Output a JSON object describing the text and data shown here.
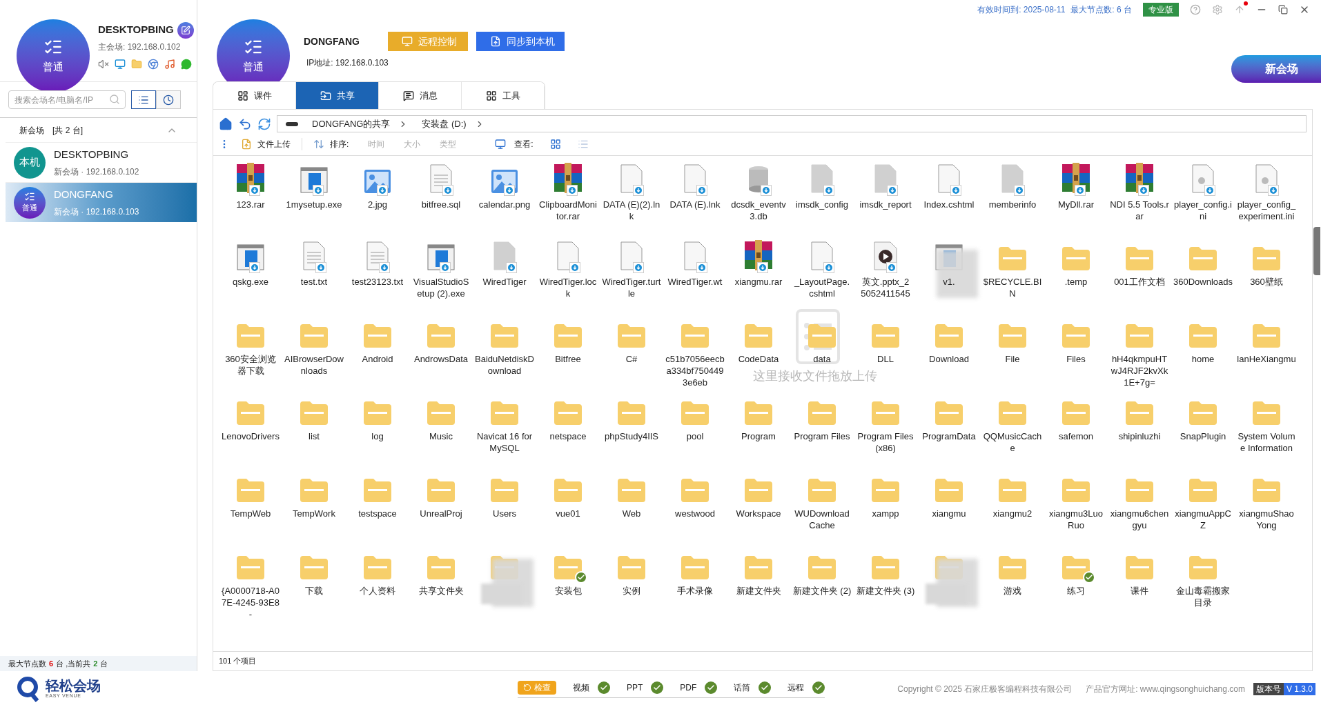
{
  "window": {
    "valid_until": "有效时间到: 2025-08-11",
    "max_nodes": "最大节点数: 6 台",
    "edition": "专业版"
  },
  "local": {
    "avatar": "普通",
    "name": "DESKTOPBING",
    "ip": "主会场: 192.168.0.102"
  },
  "sidebar": {
    "search": {
      "placeholder": "搜索会场名/电脑名/IP"
    },
    "view_toggles": [
      {
        "kind": "list",
        "selected": true
      },
      {
        "kind": "history",
        "selected": false
      }
    ],
    "group": {
      "title": "新会场",
      "count": "[共 2 台]",
      "expanded": true
    },
    "items": [
      {
        "avatar": "本机",
        "kind": "local",
        "name": "DESKTOPBING",
        "sub": "新会场 · 192.168.0.102",
        "selected": false
      },
      {
        "avatar": "普通",
        "kind": "normal",
        "name": "DONGFANG",
        "sub": "新会场 · 192.168.0.103",
        "selected": true
      }
    ],
    "footer": {
      "prefix": "最大节点数",
      "max": "6",
      "mid": "台 ,当前共",
      "current": "2",
      "suffix": "台"
    }
  },
  "logo": {
    "title": "轻松会场",
    "subtitle": "EASY VENUE"
  },
  "remote": {
    "avatar": "普通",
    "name": "DONGFANG",
    "ip": "IP地址: 192.168.0.103",
    "buttons": [
      {
        "kind": "remote",
        "label": "远程控制"
      },
      {
        "kind": "sync",
        "label": "同步到本机"
      }
    ]
  },
  "new_venue": "新会场",
  "tabs": [
    {
      "kind": "courseware",
      "label": "课件",
      "selected": false
    },
    {
      "kind": "share",
      "label": "共享",
      "selected": true
    },
    {
      "kind": "message",
      "label": "消息",
      "selected": false
    },
    {
      "kind": "tools",
      "label": "工具",
      "selected": false
    }
  ],
  "path": [
    "DONGFANG的共享",
    "安装盘 (D:)"
  ],
  "toolbar": {
    "upload": "文件上传",
    "sort_label": "排序:",
    "sort": [
      {
        "label": "时间",
        "selected": false
      },
      {
        "label": "大小",
        "selected": false
      },
      {
        "label": "类型",
        "selected": false
      }
    ],
    "view_label": "查看:",
    "views": [
      {
        "kind": "grid",
        "selected": true
      },
      {
        "kind": "list",
        "selected": false
      }
    ]
  },
  "drop_hint": "这里接收文件拖放上传",
  "files": [
    {
      "name": "123.rar",
      "kind": "rar",
      "synced": false
    },
    {
      "name": "1mysetup.exe",
      "kind": "exe",
      "synced": false
    },
    {
      "name": "2.jpg",
      "kind": "image",
      "synced": false
    },
    {
      "name": "bitfree.sql",
      "kind": "doc",
      "synced": false
    },
    {
      "name": "calendar.png",
      "kind": "image",
      "synced": false
    },
    {
      "name": "ClipboardMonitor.rar",
      "kind": "rar",
      "synced": false
    },
    {
      "name": "DATA (E)(2).lnk",
      "kind": "blank",
      "synced": false
    },
    {
      "name": "DATA (E).lnk",
      "kind": "blank",
      "synced": false
    },
    {
      "name": "dcsdk_eventv3.db",
      "kind": "db",
      "synced": false
    },
    {
      "name": "imsdk_config",
      "kind": "grey",
      "synced": false
    },
    {
      "name": "imsdk_report",
      "kind": "grey",
      "synced": false
    },
    {
      "name": "Index.cshtml",
      "kind": "blank",
      "synced": false
    },
    {
      "name": "memberinfo",
      "kind": "grey",
      "synced": false
    },
    {
      "name": "MyDll.rar",
      "kind": "rar",
      "synced": false
    },
    {
      "name": "NDI 5.5 Tools.rar",
      "kind": "rar",
      "synced": false
    },
    {
      "name": "player_config.ini",
      "kind": "ini",
      "synced": false
    },
    {
      "name": "player_config_experiment.ini",
      "kind": "ini",
      "synced": false
    },
    {
      "name": "qskg.exe",
      "kind": "exe",
      "synced": false
    },
    {
      "name": "test.txt",
      "kind": "doc",
      "synced": false
    },
    {
      "name": "test23123.txt",
      "kind": "doc",
      "synced": false
    },
    {
      "name": "VisualStudioSetup (2).exe",
      "kind": "exe",
      "synced": false
    },
    {
      "name": "WiredTiger",
      "kind": "grey",
      "synced": false
    },
    {
      "name": "WiredTiger.lock",
      "kind": "blank",
      "synced": false
    },
    {
      "name": "WiredTiger.turtle",
      "kind": "blank",
      "synced": false
    },
    {
      "name": "WiredTiger.wt",
      "kind": "blank",
      "synced": false
    },
    {
      "name": "xiangmu.rar",
      "kind": "rar",
      "synced": false
    },
    {
      "name": "_LayoutPage.cshtml",
      "kind": "blank",
      "synced": false
    },
    {
      "name": "英文.pptx_2",
      "name2": "5052411545",
      "kind": "video",
      "synced": false
    },
    {
      "name": "v1.",
      "kind": "blurred-exe",
      "synced": false
    },
    {
      "name": "$RECYCLE.BIN",
      "kind": "folder",
      "synced": false
    },
    {
      "name": ".temp",
      "kind": "folder",
      "synced": false
    },
    {
      "name": "001工作文档",
      "kind": "folder",
      "synced": false
    },
    {
      "name": "360Downloads",
      "kind": "folder",
      "synced": false
    },
    {
      "name": "360壁纸",
      "kind": "folder",
      "synced": false
    },
    {
      "name": "360安全浏览器下载",
      "kind": "folder",
      "synced": false
    },
    {
      "name": "AIBrowserDownloads",
      "kind": "folder",
      "synced": false
    },
    {
      "name": "Android",
      "kind": "folder",
      "synced": false
    },
    {
      "name": "AndrowsData",
      "kind": "folder",
      "synced": false
    },
    {
      "name": "BaiduNetdiskDownload",
      "kind": "folder",
      "synced": false
    },
    {
      "name": "Bitfree",
      "kind": "folder",
      "synced": false
    },
    {
      "name": "C#",
      "kind": "folder",
      "synced": false
    },
    {
      "name": "c51b7056eecba334bf7504493e6eb",
      "kind": "folder",
      "synced": false
    },
    {
      "name": "CodeData",
      "kind": "folder",
      "synced": false
    },
    {
      "name": "data",
      "kind": "folder",
      "synced": false
    },
    {
      "name": "DLL",
      "kind": "folder",
      "synced": false
    },
    {
      "name": "Download",
      "kind": "folder",
      "synced": false
    },
    {
      "name": "File",
      "kind": "folder",
      "synced": false
    },
    {
      "name": "Files",
      "kind": "folder",
      "synced": false
    },
    {
      "name": "hH4qkmpuHTwJ4RJF2kvXk1E+7g=",
      "kind": "folder",
      "synced": false
    },
    {
      "name": "home",
      "kind": "folder",
      "synced": false
    },
    {
      "name": "lanHeXiangmu",
      "kind": "folder",
      "synced": false
    },
    {
      "name": "LenovoDrivers",
      "kind": "folder",
      "synced": false
    },
    {
      "name": "list",
      "kind": "folder",
      "synced": false
    },
    {
      "name": "log",
      "kind": "folder",
      "synced": false
    },
    {
      "name": "Music",
      "kind": "folder",
      "synced": false
    },
    {
      "name": "Navicat 16 for MySQL",
      "kind": "folder",
      "synced": false
    },
    {
      "name": "netspace",
      "kind": "folder",
      "synced": false
    },
    {
      "name": "phpStudy4IIS",
      "kind": "folder",
      "synced": false
    },
    {
      "name": "pool",
      "kind": "folder",
      "synced": false
    },
    {
      "name": "Program",
      "kind": "folder",
      "synced": false
    },
    {
      "name": "Program Files",
      "kind": "folder",
      "synced": false
    },
    {
      "name": "Program Files (x86)",
      "kind": "folder",
      "synced": false
    },
    {
      "name": "ProgramData",
      "kind": "folder",
      "synced": false
    },
    {
      "name": "QQMusicCache",
      "kind": "folder",
      "synced": false
    },
    {
      "name": "safemon",
      "kind": "folder",
      "synced": false
    },
    {
      "name": "shipinluzhi",
      "kind": "folder",
      "synced": false
    },
    {
      "name": "SnapPlugin",
      "kind": "folder",
      "synced": false
    },
    {
      "name": "System Volume Information",
      "kind": "folder",
      "synced": false
    },
    {
      "name": "TempWeb",
      "kind": "folder",
      "synced": false
    },
    {
      "name": "TempWork",
      "kind": "folder",
      "synced": false
    },
    {
      "name": "testspace",
      "kind": "folder",
      "synced": false
    },
    {
      "name": "UnrealProj",
      "kind": "folder",
      "synced": false
    },
    {
      "name": "Users",
      "kind": "folder",
      "synced": false
    },
    {
      "name": "vue01",
      "kind": "folder",
      "synced": false
    },
    {
      "name": "Web",
      "kind": "folder",
      "synced": false
    },
    {
      "name": "westwood",
      "kind": "folder",
      "synced": false
    },
    {
      "name": "Workspace",
      "kind": "folder",
      "synced": false
    },
    {
      "name": "WUDownloadCache",
      "kind": "folder",
      "synced": false
    },
    {
      "name": "xampp",
      "kind": "folder",
      "synced": false
    },
    {
      "name": "xiangmu",
      "kind": "folder",
      "synced": false
    },
    {
      "name": "xiangmu2",
      "kind": "folder",
      "synced": false
    },
    {
      "name": "xiangmu3LuoRuo",
      "kind": "folder",
      "synced": false
    },
    {
      "name": "xiangmu6chengyu",
      "kind": "folder",
      "synced": false
    },
    {
      "name": "xiangmuAppCZ",
      "kind": "folder",
      "synced": false
    },
    {
      "name": "xiangmuShaoYong",
      "kind": "folder",
      "synced": false
    },
    {
      "name": "{A0000718-A07E-4245-93E8-",
      "kind": "folder",
      "synced": false
    },
    {
      "name": "下载",
      "kind": "folder",
      "synced": false
    },
    {
      "name": "个人资料",
      "kind": "folder",
      "synced": false
    },
    {
      "name": "共享文件夹",
      "kind": "folder",
      "synced": false
    },
    {
      "kind": "blurred-folder",
      "synced": false
    },
    {
      "name": "安装包",
      "kind": "folder",
      "synced": true
    },
    {
      "name": "实例",
      "kind": "folder",
      "synced": false
    },
    {
      "name": "手术录像",
      "kind": "folder",
      "synced": false
    },
    {
      "name": "新建文件夹",
      "kind": "folder",
      "synced": false
    },
    {
      "name": "新建文件夹 (2)",
      "kind": "folder",
      "synced": false
    },
    {
      "name": "新建文件夹 (3)",
      "kind": "folder",
      "synced": false
    },
    {
      "kind": "blurred-folder",
      "synced": false
    },
    {
      "name": "游戏",
      "kind": "folder",
      "synced": false
    },
    {
      "name": "练习",
      "kind": "folder",
      "synced": true
    },
    {
      "name": "课件",
      "kind": "folder",
      "synced": false
    },
    {
      "name": "金山毒霸搬家目录",
      "kind": "folder",
      "synced": false
    }
  ],
  "item_count": "101 个项目",
  "checks": {
    "button": "检查",
    "items": [
      {
        "label": "视频",
        "ok": true
      },
      {
        "label": "PPT",
        "ok": true
      },
      {
        "label": "PDF",
        "ok": true
      },
      {
        "label": "话筒",
        "ok": true
      },
      {
        "label": "远程",
        "ok": true
      }
    ]
  },
  "copyright": "Copyright © 2025 石家庄极客编程科技有限公司",
  "website": "产品官方网址: www.qingsonghuichang.com",
  "version": {
    "label": "版本号",
    "value": "V 1.3.0"
  }
}
